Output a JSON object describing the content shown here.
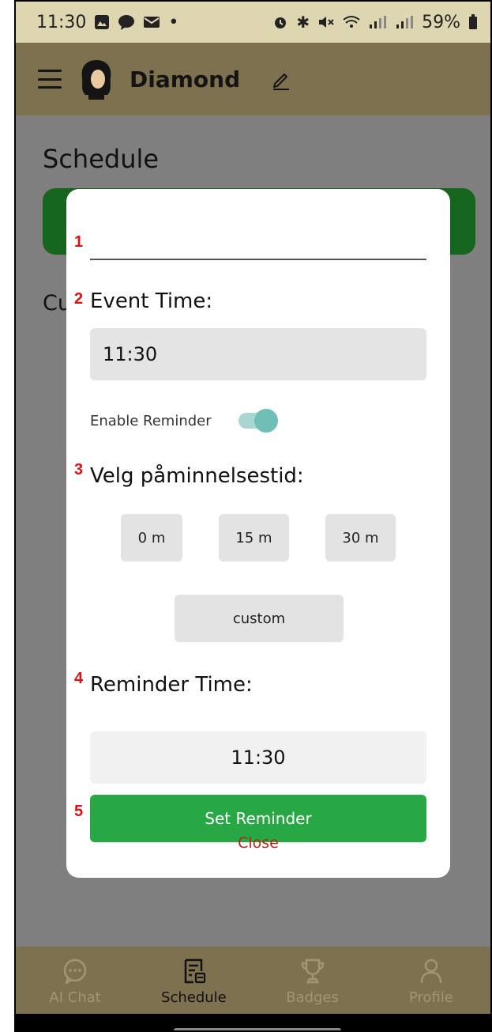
{
  "status_bar": {
    "time": "11:30",
    "battery": "59%"
  },
  "app_bar": {
    "title": "Diamond"
  },
  "page": {
    "title": "Schedule",
    "partial_text": "Cu"
  },
  "dialog": {
    "title_input": {
      "value": "",
      "placeholder": ""
    },
    "event_time_label": "Event Time:",
    "event_time_value": "11:30",
    "enable_reminder_label": "Enable Reminder",
    "enable_reminder_on": true,
    "reminder_choice_label": "Velg påminnelsestid:",
    "options": [
      "0 m",
      "15 m",
      "30 m"
    ],
    "custom_label": "custom",
    "reminder_time_label": "Reminder Time:",
    "reminder_time_value": "11:30",
    "set_button": "Set Reminder",
    "close_label": "Close"
  },
  "markers": [
    "1",
    "2",
    "3",
    "4",
    "5"
  ],
  "bottom_nav": [
    {
      "label": "AI Chat",
      "icon": "chat-icon",
      "active": false
    },
    {
      "label": "Schedule",
      "icon": "schedule-icon",
      "active": true
    },
    {
      "label": "Badges",
      "icon": "trophy-icon",
      "active": false
    },
    {
      "label": "Profile",
      "icon": "profile-icon",
      "active": false
    }
  ],
  "colors": {
    "app_bar": "#7d7150",
    "primary_button": "#28a745",
    "close": "#b3261e",
    "toggle": "#6fbfb6",
    "overlay": "#7f7f7f"
  }
}
